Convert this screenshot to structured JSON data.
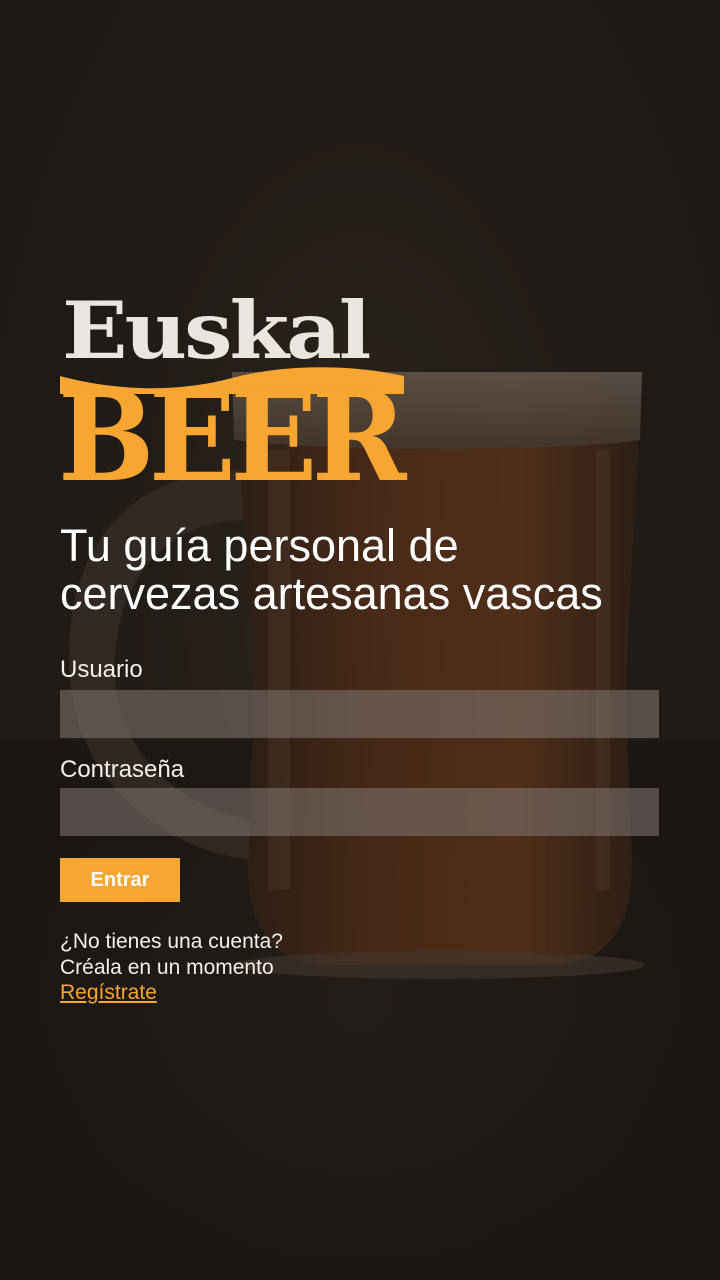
{
  "logo": {
    "line1": "Euskal",
    "line2": "BEER"
  },
  "tagline": {
    "line1": "Tu guía personal de",
    "line2": "cervezas artesanas vascas"
  },
  "form": {
    "username_label": "Usuario",
    "username_value": "",
    "password_label": "Contraseña",
    "password_value": "",
    "submit_label": "Entrar"
  },
  "signup": {
    "question": "¿No tienes una cuenta?",
    "subtext": "Créala en un momento",
    "link_label": "Regístrate"
  },
  "colors": {
    "accent": "#f6a631",
    "background": "#231e1a",
    "logo_light": "#e9e6e2",
    "input_bg": "#7f7671"
  },
  "icons": {
    "background_image": "beer-mug-icon"
  }
}
